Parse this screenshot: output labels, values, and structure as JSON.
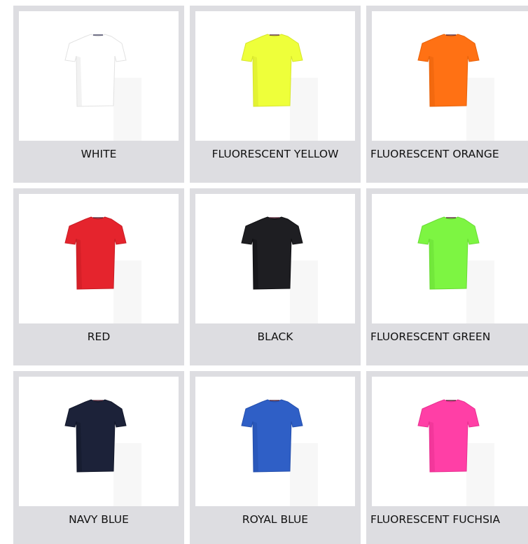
{
  "colors": [
    {
      "label": "WHITE",
      "shirt": "#ffffff",
      "shade": "#e6e6e6",
      "icon": "tshirt-icon"
    },
    {
      "label": "FLUORESCENT YELLOW",
      "shirt": "#eeff3a",
      "shade": "#d7e62c",
      "icon": "tshirt-icon"
    },
    {
      "label": "FLUORESCENT ORANGE",
      "shirt": "#ff7114",
      "shade": "#e86209",
      "icon": "tshirt-icon"
    },
    {
      "label": "RED",
      "shirt": "#e5242d",
      "shade": "#c81c24",
      "icon": "tshirt-icon"
    },
    {
      "label": "BLACK",
      "shirt": "#1e1e22",
      "shade": "#101013",
      "icon": "tshirt-icon"
    },
    {
      "label": "FLUORESCENT GREEN",
      "shirt": "#7df542",
      "shade": "#68dc33",
      "icon": "tshirt-icon"
    },
    {
      "label": "NAVY BLUE",
      "shirt": "#1c2239",
      "shade": "#12172a",
      "icon": "tshirt-icon"
    },
    {
      "label": "ROYAL BLUE",
      "shirt": "#2f5fc6",
      "shade": "#244fad",
      "icon": "tshirt-icon"
    },
    {
      "label": "FLUORESCENT FUCHSIA",
      "shirt": "#ff3fa6",
      "shade": "#e82f90",
      "icon": "tshirt-icon"
    }
  ]
}
